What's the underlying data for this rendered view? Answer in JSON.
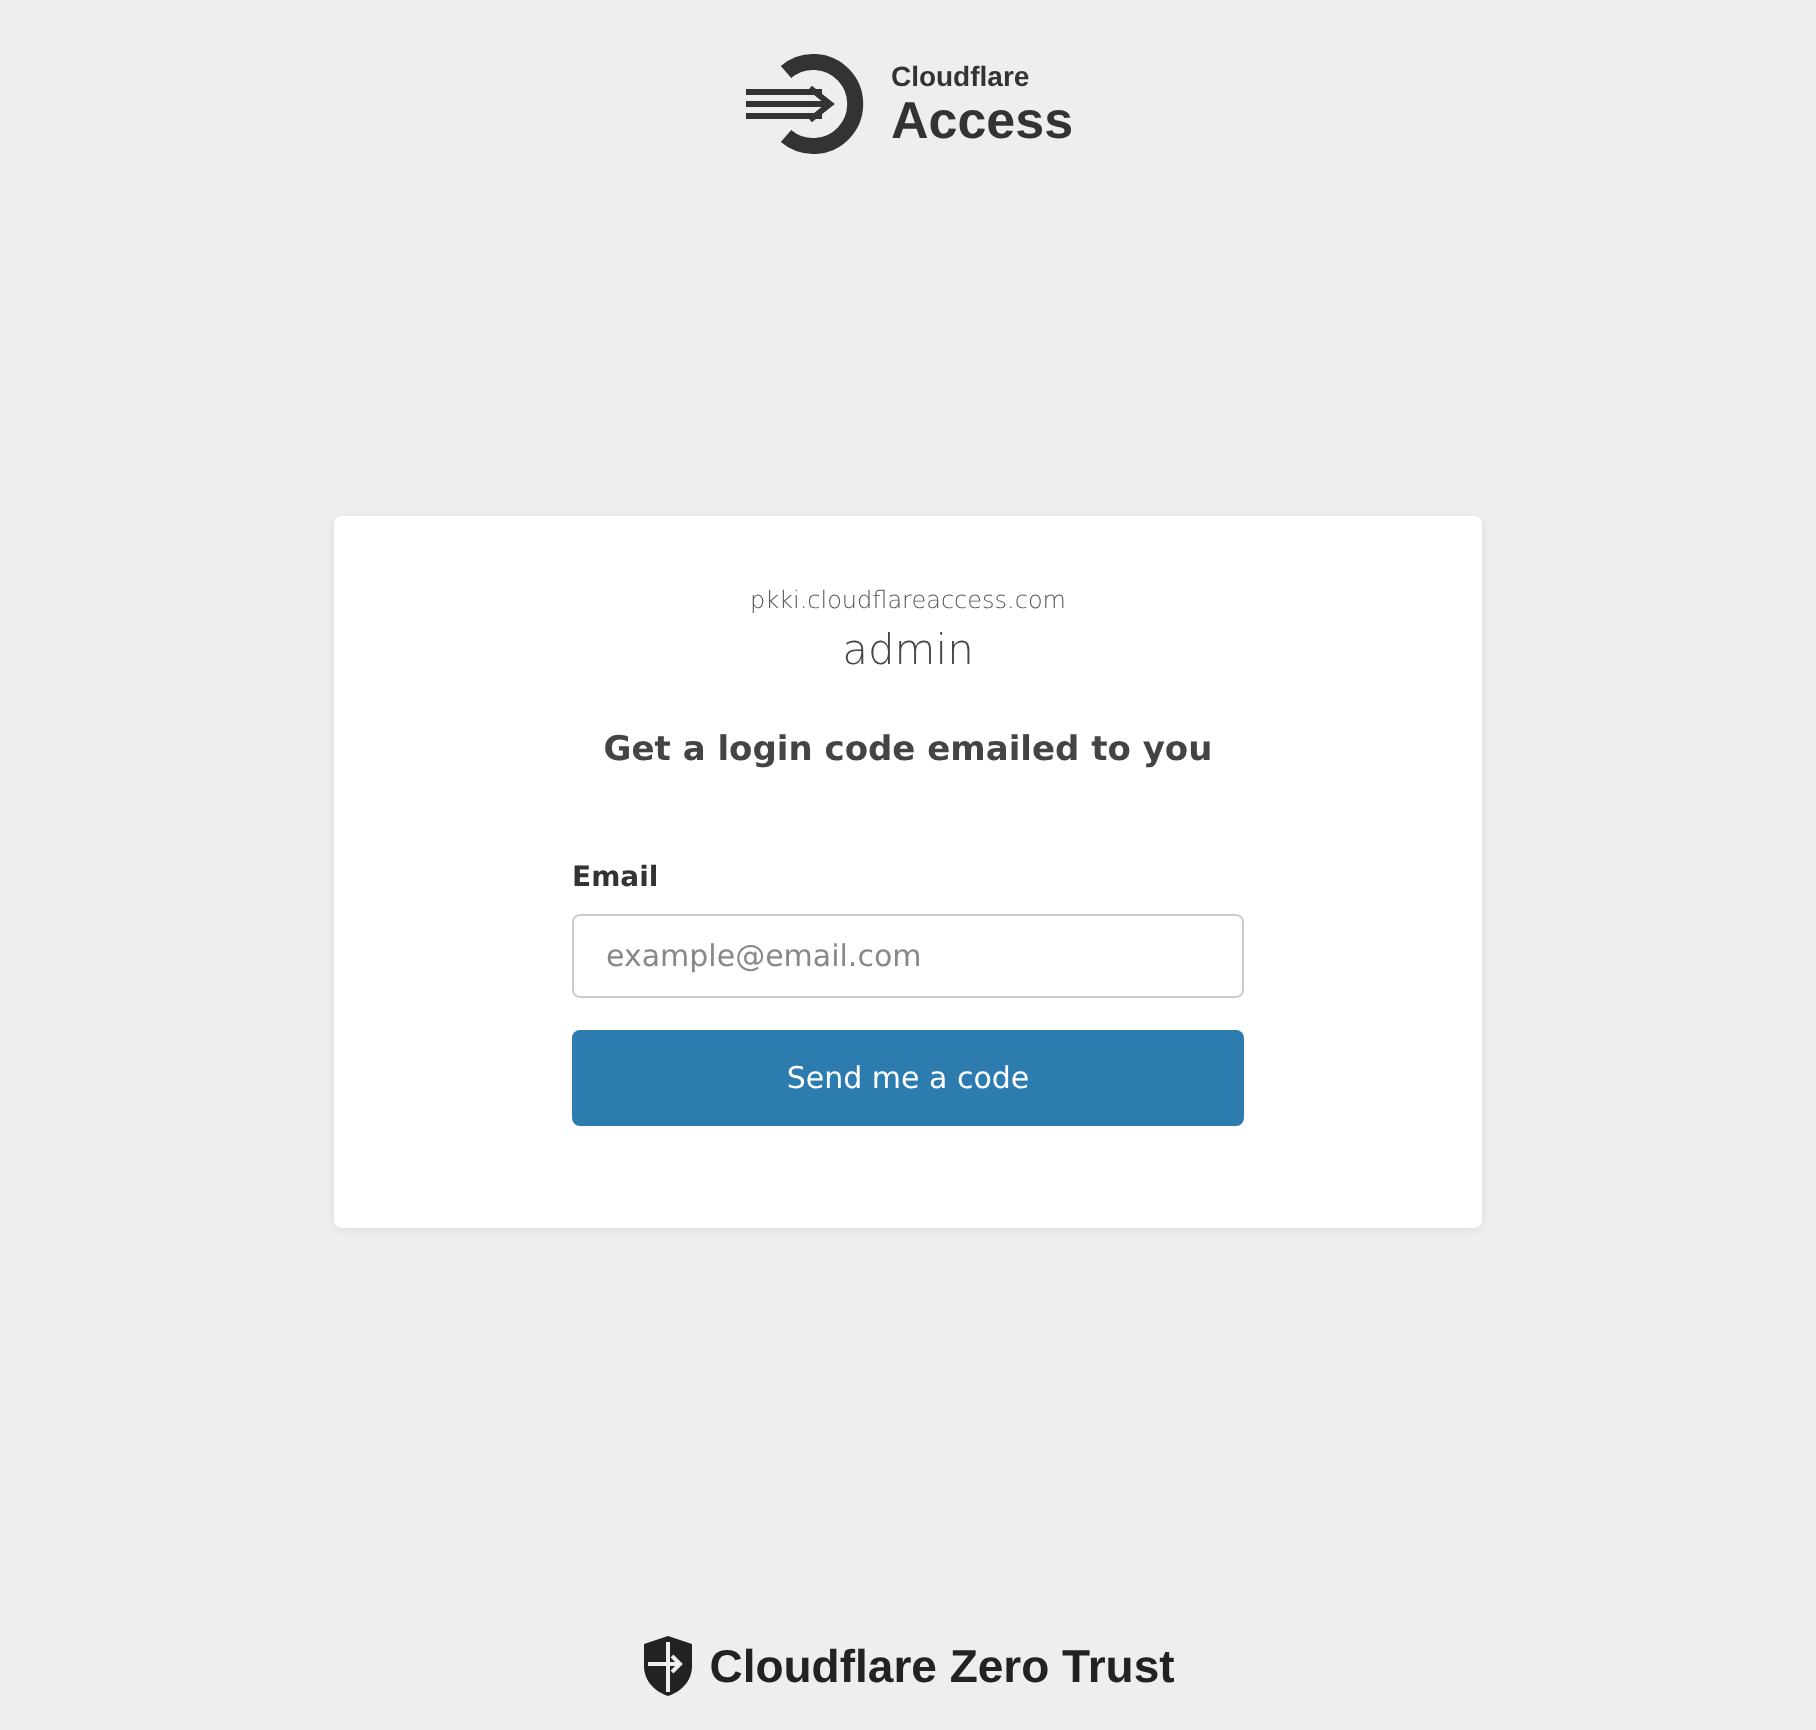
{
  "header": {
    "brand_small": "Cloudflare",
    "brand_large": "Access"
  },
  "card": {
    "domain": "pkki.cloudflareaccess.com",
    "app_name": "admin",
    "heading": "Get a login code emailed to you",
    "email_label": "Email",
    "email_placeholder": "example@email.com",
    "button": "Send me a code"
  },
  "footer": {
    "brand": "Cloudflare Zero Trust"
  }
}
